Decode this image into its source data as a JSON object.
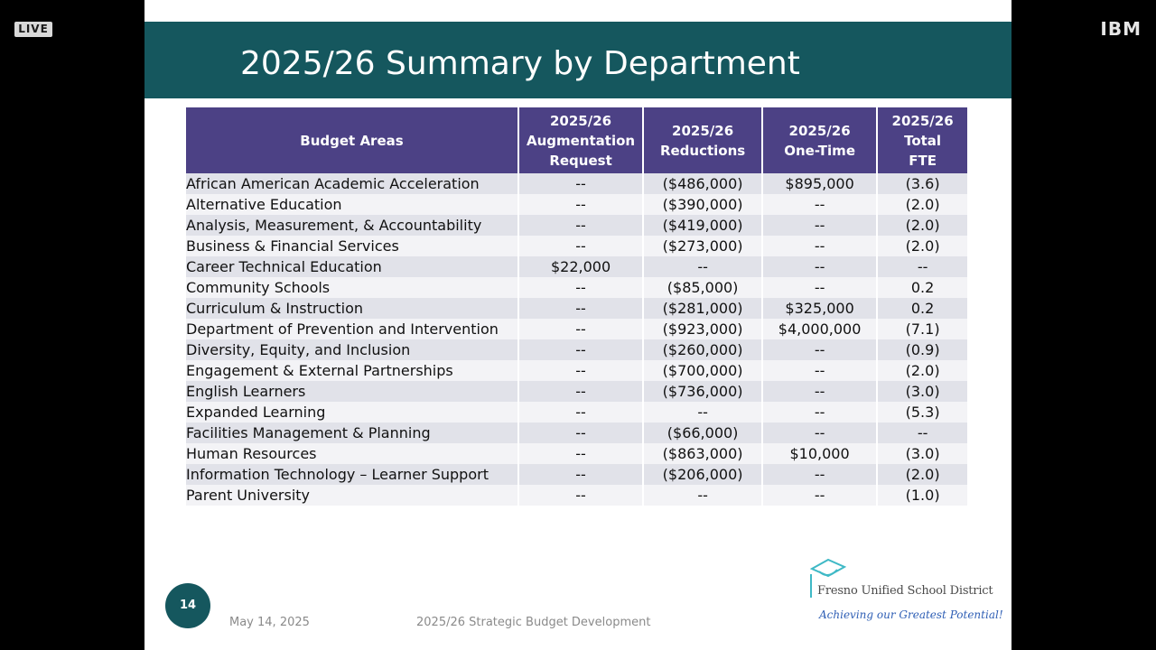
{
  "overlay": {
    "live_label": "LIVE",
    "brand": "IBM"
  },
  "slide": {
    "title": "2025/26 Summary by Department",
    "table": {
      "headers": [
        "Budget Areas",
        "2025/26 Augmentation Request",
        "2025/26 Reductions",
        "2025/26 One-Time",
        "2025/26 Total FTE"
      ],
      "rows": [
        [
          "African American Academic Acceleration",
          "--",
          "($486,000)",
          "$895,000",
          "(3.6)"
        ],
        [
          "Alternative Education",
          "--",
          "($390,000)",
          "--",
          "(2.0)"
        ],
        [
          "Analysis, Measurement, & Accountability",
          "--",
          "($419,000)",
          "--",
          "(2.0)"
        ],
        [
          "Business & Financial Services",
          "--",
          "($273,000)",
          "--",
          "(2.0)"
        ],
        [
          "Career Technical Education",
          "$22,000",
          "--",
          "--",
          "--"
        ],
        [
          "Community Schools",
          "--",
          "($85,000)",
          "--",
          "0.2"
        ],
        [
          "Curriculum & Instruction",
          "--",
          "($281,000)",
          "$325,000",
          "0.2"
        ],
        [
          "Department of Prevention and Intervention",
          "--",
          "($923,000)",
          "$4,000,000",
          "(7.1)"
        ],
        [
          "Diversity, Equity, and Inclusion",
          "--",
          "($260,000)",
          "--",
          "(0.9)"
        ],
        [
          "Engagement & External Partnerships",
          "--",
          "($700,000)",
          "--",
          "(2.0)"
        ],
        [
          "English Learners",
          "--",
          "($736,000)",
          "--",
          "(3.0)"
        ],
        [
          "Expanded Learning",
          "--",
          "--",
          "--",
          "(5.3)"
        ],
        [
          "Facilities Management & Planning",
          "--",
          "($66,000)",
          "--",
          "--"
        ],
        [
          "Human Resources",
          "--",
          "($863,000)",
          "$10,000",
          "(3.0)"
        ],
        [
          "Information Technology – Learner Support",
          "--",
          "($206,000)",
          "--",
          "(2.0)"
        ],
        [
          "Parent University",
          "--",
          "--",
          "--",
          "(1.0)"
        ]
      ]
    },
    "footer": {
      "page_number": "14",
      "date": "May 14, 2025",
      "center_text": "2025/26 Strategic Budget Development",
      "logo_name": "Fresno Unified School District",
      "logo_tagline": "Achieving our Greatest Potential!"
    }
  },
  "colors": {
    "title_bar": "#15575e",
    "header_bg": "#4c4185",
    "row_odd": "#e1e2e9",
    "row_even": "#f3f3f6"
  }
}
